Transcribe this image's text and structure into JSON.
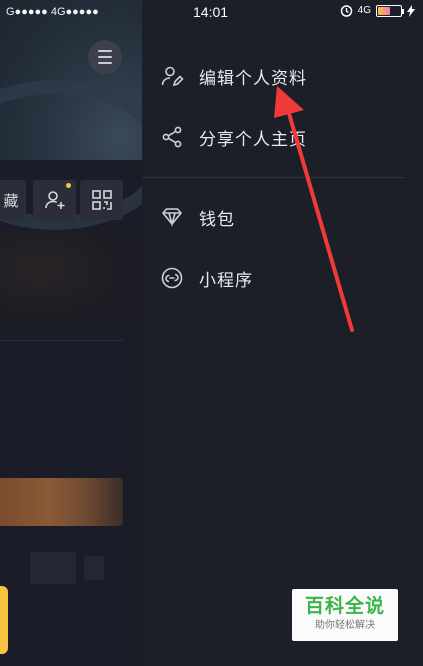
{
  "status_bar": {
    "left_signal": "G●●●●● 4G●●●●●",
    "time": "14:01",
    "network": "4G",
    "battery_level": 0.55
  },
  "profile_background": {
    "action_fav_label": "藏"
  },
  "drawer": {
    "items": [
      {
        "label": "编辑个人资料",
        "icon": "edit-profile-icon"
      },
      {
        "label": "分享个人主页",
        "icon": "share-icon"
      },
      {
        "label": "钱包",
        "icon": "wallet-diamond-icon"
      },
      {
        "label": "小程序",
        "icon": "mini-program-icon"
      }
    ]
  },
  "annotation": {
    "arrow_color": "#f03a3a"
  },
  "watermark": {
    "title": "百科全说",
    "subtitle": "助你轻松解决"
  },
  "colors": {
    "drawer_bg": "#1c1e28",
    "accent_yellow": "#f5c542",
    "watermark_green": "#39b54a"
  }
}
